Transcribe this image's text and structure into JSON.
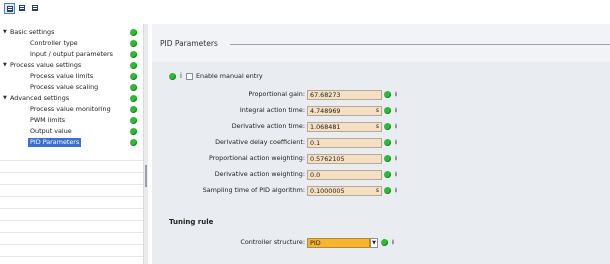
{
  "tree": {
    "items": [
      {
        "label": "Basic settings",
        "level": 0,
        "arrow": "▼"
      },
      {
        "label": "Controller type",
        "level": 1
      },
      {
        "label": "Input / output parameters",
        "level": 1
      },
      {
        "label": "Process value settings",
        "level": 0,
        "arrow": "▼"
      },
      {
        "label": "Process value limits",
        "level": 1
      },
      {
        "label": "Process value scaling",
        "level": 1
      },
      {
        "label": "Advanced settings",
        "level": 0,
        "arrow": "▼"
      },
      {
        "label": "Process value monitoring",
        "level": 1
      },
      {
        "label": "PWM limits",
        "level": 1
      },
      {
        "label": "Output value",
        "level": 1
      },
      {
        "label": "PID Parameters",
        "level": 1,
        "selected": true
      }
    ]
  },
  "panel": {
    "title": "PID Parameters",
    "manual_entry_label": "Enable manual entry",
    "parameters": [
      {
        "label": "Proportional gain:",
        "value": "67.68273",
        "unit": ""
      },
      {
        "label": "Integral action time:",
        "value": "4.748969",
        "unit": "s"
      },
      {
        "label": "Derivative action time:",
        "value": "1.068481",
        "unit": "s"
      },
      {
        "label": "Derivative delay coefficient:",
        "value": "0.1",
        "unit": ""
      },
      {
        "label": "Proportional action weighting:",
        "value": "0.5762105",
        "unit": ""
      },
      {
        "label": "Derivative action weighting:",
        "value": "0.0",
        "unit": ""
      },
      {
        "label": "Sampling time of PID algorithm:",
        "value": "0.1000005",
        "unit": "s"
      }
    ],
    "tuning_rule_title": "Tuning rule",
    "controller_structure_label": "Controller structure:",
    "controller_structure_value": "PID"
  },
  "colors": {
    "status_ok": "#2dbb36",
    "selection": "#3b6fd0",
    "field_bg": "#f4e1c3",
    "dropdown_bg": "#f5b52f"
  }
}
